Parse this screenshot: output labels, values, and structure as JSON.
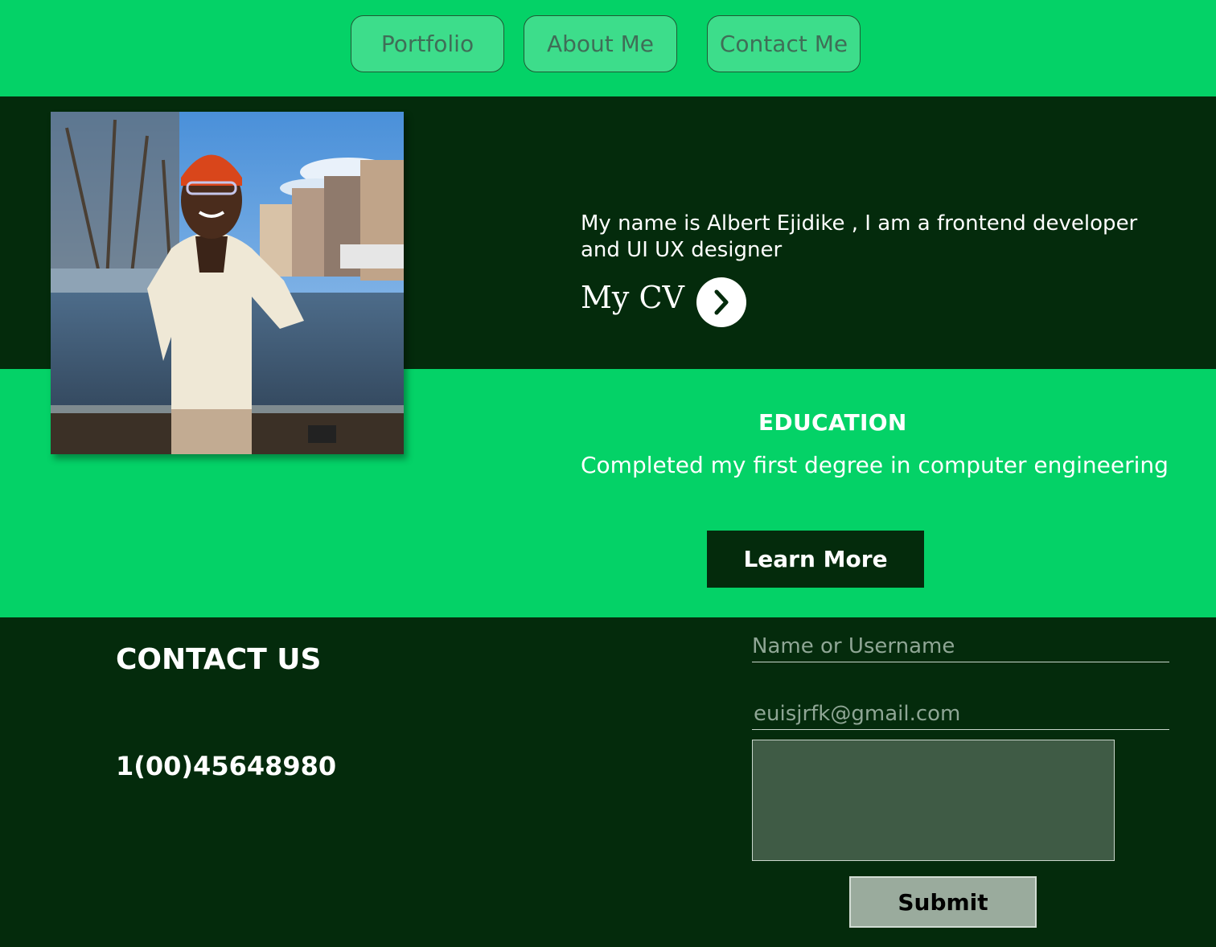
{
  "nav": {
    "items": [
      {
        "label": "Portfolio"
      },
      {
        "label": "About Me"
      },
      {
        "label": "Contact Me"
      }
    ]
  },
  "hero": {
    "intro": "My name is Albert Ejidike , I am a frontend developer and UI UX designer",
    "cv_label": "My CV",
    "cv_icon": "chevron-right-icon"
  },
  "education": {
    "title": "EDUCATION",
    "text": "Completed my first degree in computer engineering",
    "button_label": "Learn More"
  },
  "contact": {
    "title": "CONTACT US",
    "phone": "1(00)45648980",
    "name_placeholder": "Name or Username",
    "email_value": "euisjrfk@gmail.com",
    "submit_label": "Submit"
  },
  "colors": {
    "brand_green": "#04d267",
    "dark_green": "#042b0c",
    "nav_button": "#3ddd8b",
    "submit_button": "#9aab9d"
  }
}
